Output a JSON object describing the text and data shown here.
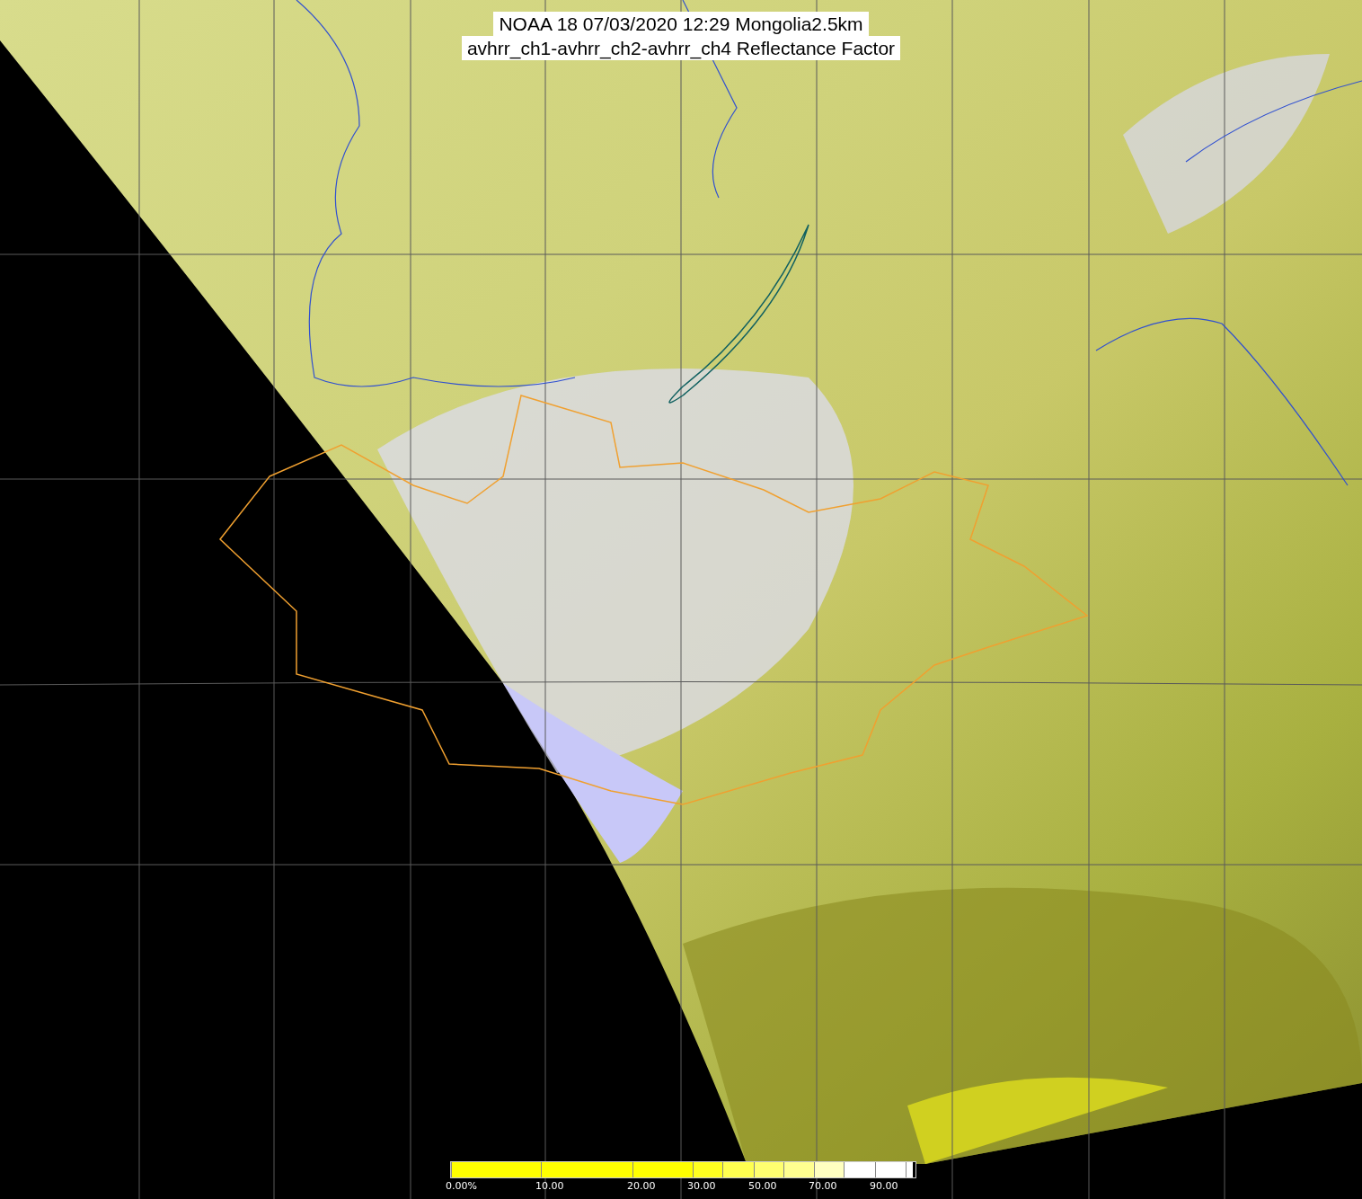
{
  "title": {
    "lines": [
      "NOAA 18 07/03/2020 12:29 Mongolia2.5km",
      "avhrr_ch1-avhrr_ch2-avhrr_ch4 Reflectance Factor"
    ]
  },
  "colorbar": {
    "segments": [
      {
        "color": "#ffff00",
        "label": "0.00%"
      },
      {
        "color": "#ffff00",
        "label": "10.00"
      },
      {
        "color": "#ffff00",
        "label": "20.00"
      },
      {
        "color": "#ffff20",
        "label": "30.00"
      },
      {
        "color": "#ffff50"
      },
      {
        "color": "#ffff70",
        "label": "50.00"
      },
      {
        "color": "#ffff90"
      },
      {
        "color": "#ffffc0",
        "label": "70.00"
      },
      {
        "color": "#ffffff"
      },
      {
        "color": "#ffffff",
        "label": "90.00"
      },
      {
        "color": "#ffffff"
      }
    ]
  }
}
